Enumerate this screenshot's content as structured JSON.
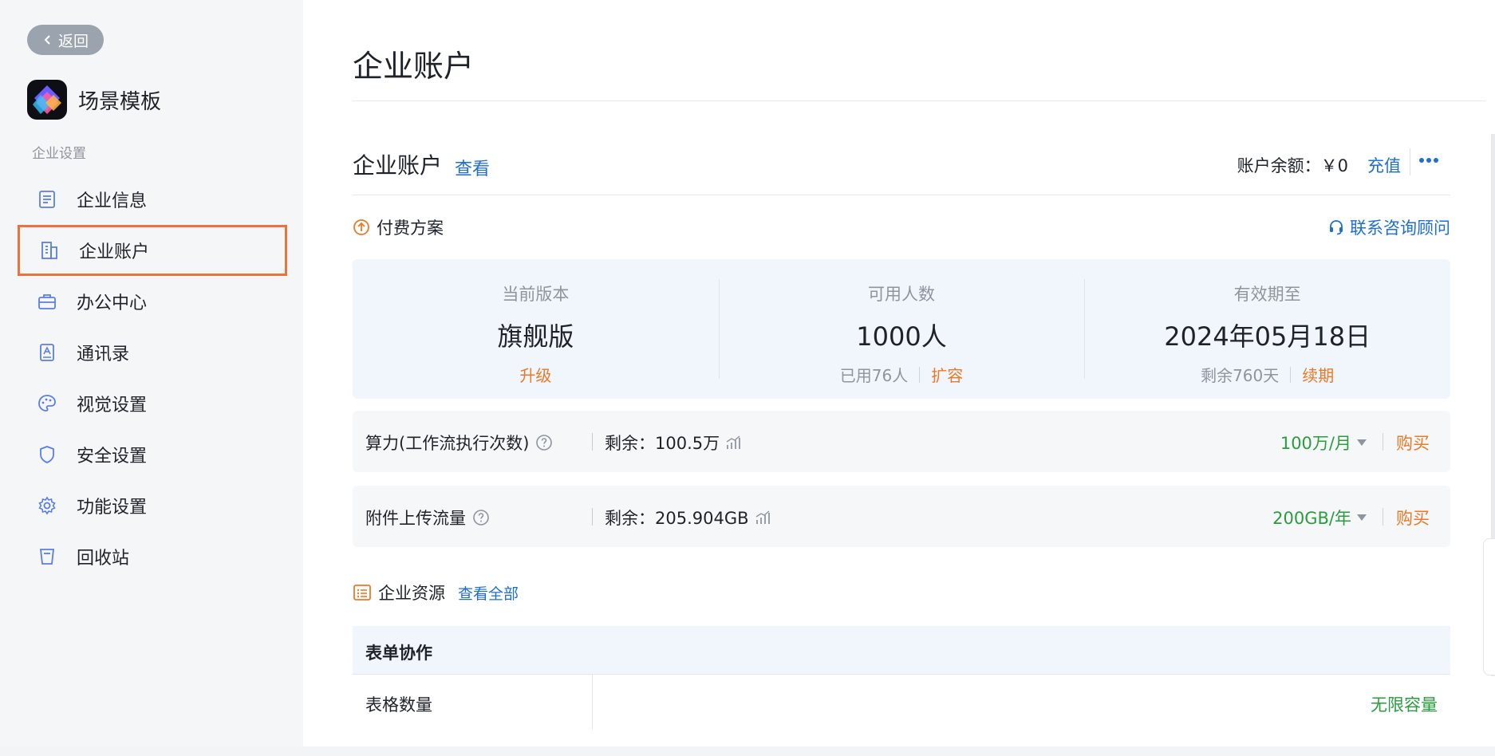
{
  "colors": {
    "accent_blue": "#1d6fd1",
    "accent_orange": "#ea7a27",
    "accent_green": "#2a9d3f",
    "highlight_border": "#ea7440"
  },
  "sidebar": {
    "back_label": "返回",
    "app_name": "场景模板",
    "group_label": "企业设置",
    "items": [
      {
        "label": "企业信息",
        "icon": "document-icon"
      },
      {
        "label": "企业账户",
        "icon": "building-icon"
      },
      {
        "label": "办公中心",
        "icon": "briefcase-icon"
      },
      {
        "label": "通讯录",
        "icon": "contacts-icon"
      },
      {
        "label": "视觉设置",
        "icon": "palette-icon"
      },
      {
        "label": "安全设置",
        "icon": "shield-icon"
      },
      {
        "label": "功能设置",
        "icon": "gear-icon"
      },
      {
        "label": "回收站",
        "icon": "trash-icon"
      }
    ],
    "active_index": 1
  },
  "main": {
    "page_title": "企业账户",
    "account": {
      "title": "企业账户",
      "view_label": "查看",
      "balance_label": "账户余额：￥0",
      "recharge_label": "充值"
    },
    "plan": {
      "label": "付费方案",
      "consult_label": "联系咨询顾问",
      "columns": [
        {
          "label": "当前版本",
          "value": "旗舰版",
          "sub_text": "",
          "action": "升级"
        },
        {
          "label": "可用人数",
          "value": "1000人",
          "sub_text": "已用76人",
          "action": "扩容"
        },
        {
          "label": "有效期至",
          "value": "2024年05月18日",
          "sub_text": "剩余760天",
          "action": "续期"
        }
      ]
    },
    "resources": [
      {
        "name": "算力(工作流执行次数)",
        "remain": "剩余：100.5万",
        "plan": "100万/月",
        "buy": "购买"
      },
      {
        "name": "附件上传流量",
        "remain": "剩余：205.904GB",
        "plan": "200GB/年",
        "buy": "购买"
      }
    ],
    "enterprise": {
      "label": "企业资源",
      "view_all": "查看全部",
      "table": {
        "section": "表单协作",
        "rows": [
          {
            "name": "表格数量",
            "value": "无限容量"
          }
        ]
      }
    }
  }
}
